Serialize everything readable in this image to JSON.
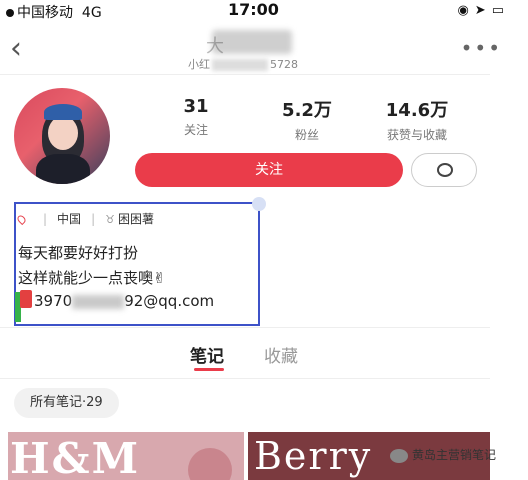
{
  "status_bar": {
    "carrier": "中国移动",
    "network": "4G",
    "time": "17:00"
  },
  "nav": {
    "title": "大",
    "subtitle_prefix": "小红",
    "subtitle_suffix": "5728"
  },
  "profile": {
    "stats": [
      {
        "value": "31",
        "label": "关注"
      },
      {
        "value": "5.2万",
        "label": "粉丝"
      },
      {
        "value": "14.6万",
        "label": "获赞与收藏"
      }
    ],
    "follow_label": "关注",
    "location": "中国",
    "zodiac": "困困薯",
    "bio_line1": "每天都要好好打扮",
    "bio_line2": "这样就能少一点丧噢✌",
    "email_prefix": "3970",
    "email_suffix": "92@qq.com"
  },
  "tabs": [
    {
      "label": "笔记",
      "active": true
    },
    {
      "label": "收藏",
      "active": false
    }
  ],
  "filter_pill": "所有笔记·29",
  "thumbnails": [
    {
      "text": "H&M"
    },
    {
      "text": "Berry"
    }
  ],
  "watermark": "黄岛主营销笔记",
  "colors": {
    "accent": "#ea3c4a",
    "annotation": "#3d52c8"
  }
}
